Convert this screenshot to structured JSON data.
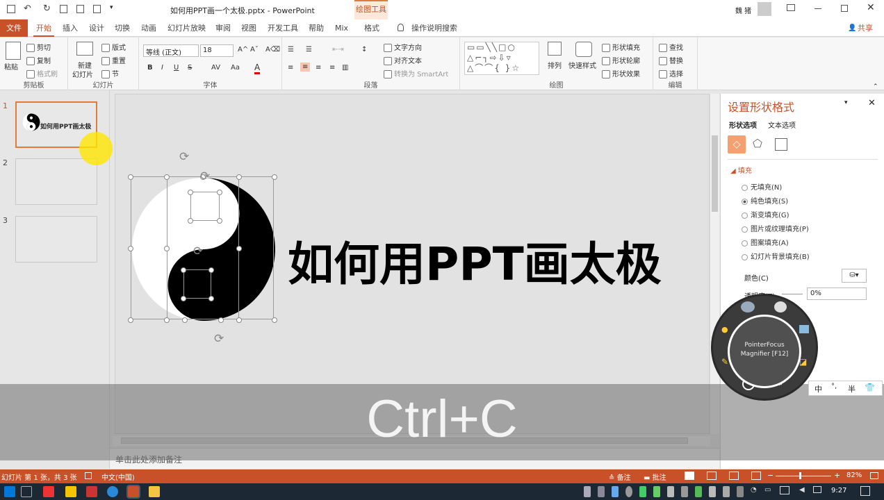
{
  "titlebar": {
    "filename": "如何用PPT画一个太极.pptx - PowerPoint",
    "contextual_tab": "绘图工具",
    "user": "魏 猪"
  },
  "tabs": [
    "文件",
    "开始",
    "插入",
    "设计",
    "切换",
    "动画",
    "幻灯片放映",
    "审阅",
    "视图",
    "开发工具",
    "帮助",
    "Mix",
    "格式"
  ],
  "tell_me": "操作说明搜索",
  "share": "共享",
  "ribbon": {
    "clipboard": {
      "paste": "粘贴",
      "cut": "剪切",
      "copy": "复制",
      "painter": "格式刷",
      "label": "剪贴板"
    },
    "slides": {
      "new": "新建",
      "new2": "幻灯片",
      "layout": "版式",
      "reset": "重置",
      "section": "节",
      "label": "幻灯片"
    },
    "font": {
      "name": "等线 (正文)",
      "size": "18",
      "label": "字体",
      "bold": "B",
      "italic": "I",
      "underline": "U",
      "strike": "S",
      "spacing": "AV",
      "case": "Aa",
      "color": "A"
    },
    "paragraph": {
      "direction": "文字方向",
      "align": "对齐文本",
      "smartart": "转换为 SmartArt",
      "label": "段落"
    },
    "drawing": {
      "arrange": "排列",
      "quick": "快速样式",
      "fill": "形状填充",
      "outline": "形状轮廓",
      "effect": "形状效果",
      "label": "绘图"
    },
    "editing": {
      "find": "查找",
      "replace": "替换",
      "select": "选择",
      "label": "编辑"
    }
  },
  "slides_pane": {
    "numbers": [
      "1",
      "2",
      "3"
    ],
    "thumb1_title": "如何用PPT画太极"
  },
  "slide": {
    "title": "如何用PPT画太极"
  },
  "notes_placeholder": "单击此处添加备注",
  "format_pane": {
    "title": "设置形状格式",
    "tab_shape": "形状选项",
    "tab_text": "文本选项",
    "section": "填充",
    "options": [
      "无填充(N)",
      "纯色填充(S)",
      "渐变填充(G)",
      "图片或纹理填充(P)",
      "图案填充(A)",
      "幻灯片背景填充(B)"
    ],
    "selected_index": 1,
    "color_label": "颜色(C)",
    "transparency_label": "透明度(T)",
    "transparency_value": "0%"
  },
  "overlay_key": "Ctrl+C",
  "magnifier": {
    "line1": "PointerFocus",
    "line2": "Magnifier [F12]"
  },
  "ime": {
    "lang": "中",
    "punct": "°,",
    "width": "半"
  },
  "statusbar": {
    "slide_info": "幻灯片 第 1 张，共 3 张",
    "language": "中文(中国)",
    "notes": "备注",
    "comments": "批注",
    "zoom": "82%"
  },
  "taskbar": {
    "time": "9:27"
  },
  "colors": {
    "accent": "#c9512a",
    "ribbon": "#f7f7f7",
    "statusbar": "#c9512a"
  }
}
